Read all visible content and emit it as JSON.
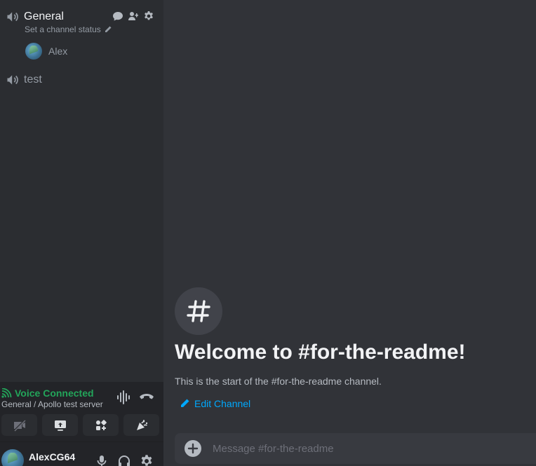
{
  "sidebar": {
    "channels": [
      {
        "name": "General",
        "status_placeholder": "Set a channel status",
        "users": [
          {
            "name": "Alex"
          }
        ]
      },
      {
        "name": "test"
      }
    ]
  },
  "voice": {
    "status": "Voice Connected",
    "location": "General / Apollo test server"
  },
  "user": {
    "name": "AlexCG64"
  },
  "main": {
    "welcome_icon": "hashtag-icon",
    "welcome_title": "Welcome to #for-the-readme!",
    "welcome_subtitle": "This is the start of the #for-the-readme channel.",
    "edit_label": "Edit Channel",
    "composer_placeholder": "Message #for-the-readme"
  },
  "colors": {
    "accent_link": "#00a8fc",
    "voice_connected": "#23a55a",
    "sidebar_bg": "#2b2d31",
    "main_bg": "#313338"
  }
}
